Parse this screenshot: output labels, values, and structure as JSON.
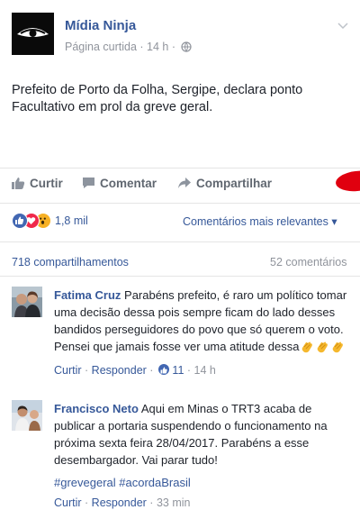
{
  "post": {
    "page_name": "Mídia Ninja",
    "meta_text": "Página curtida · 14 h ·",
    "text": "Prefeito de Porto da Folha, Sergipe, declara ponto Facultativo em prol da greve geral."
  },
  "actions": {
    "like": "Curtir",
    "comment": "Comentar",
    "share": "Compartilhar"
  },
  "reactions": {
    "count": "1,8 mil",
    "sort_label": "Comentários mais relevantes"
  },
  "stats": {
    "shares": "718 compartilhamentos",
    "comments": "52 comentários"
  },
  "comments": [
    {
      "name": "Fatima Cruz",
      "text": "Parabéns prefeito, é raro um político tomar uma decisão dessa pois sempre ficam do lado desses bandidos perseguidores do povo que só querem o voto. Pensei que jamais fosse ver uma atitude dessa",
      "like": "Curtir",
      "reply": "Responder",
      "likes": "11",
      "time": "14 h"
    },
    {
      "name": "Francisco Neto",
      "text": "Aqui em Minas o TRT3 acaba de publicar a portaria suspendendo o funcionamento na próxima sexta feira 28/04/2017. Parabéns a esse desembargador. Vai parar tudo!",
      "hashtags": "#grevegeral #acordaBrasil",
      "like": "Curtir",
      "reply": "Responder",
      "time": "33 min"
    }
  ],
  "colors": {
    "link": "#365899",
    "muted": "#90949c",
    "like_blue": "#4267b2",
    "love_red": "#f0284a",
    "wow_yellow": "#f7b125",
    "scribble_red": "#e0000f"
  }
}
